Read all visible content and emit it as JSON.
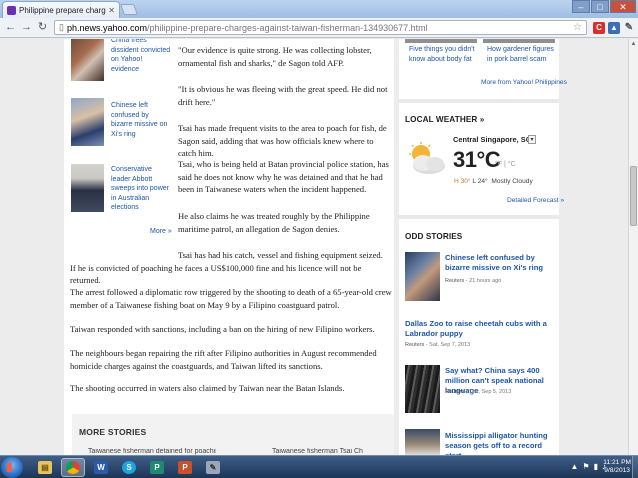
{
  "browser": {
    "tab_title": "Philippine prepare charge",
    "url_host": "ph.news.yahoo.com",
    "url_path": "/philippine-prepare-charges-against-taiwan-fisherman-134930677.html"
  },
  "left_sidebar": {
    "items": [
      {
        "title": "China frees dissident convicted on Yahoo! evidence"
      },
      {
        "title": "Chinese left confused by bizarre missive on Xi's ring"
      },
      {
        "title": "Conservative leader Abbott sweeps into power in Australian elections"
      }
    ],
    "more_label": "More »"
  },
  "article": {
    "paragraphs": [
      "\"Our evidence is quite strong. He was collecting lobster, ornamental fish and sharks,\" de Sagon told AFP.",
      "\"It is obvious he was fleeing with the great speed. He did not drift here.\"",
      "Tsai has made frequent visits to the area to poach for fish, de Sagon said, adding that was how officials knew where to catch him.",
      "Tsai, who is being held at Batan provincial police station, has said he does not know why he was detained and that he had been in Taiwanese waters when the incident happened.",
      "He also claims he was treated roughly by the Philippine maritime patrol, an allegation de Sagon denies.",
      "Tsai has had his catch, vessel and fishing equipment seized. If he is convicted of poaching he faces a US$100,000 fine and his licence will not be returned.",
      "The arrest followed a diplomatic row triggered by the shooting to death of a 65-year-old crew member of a Taiwanese fishing boat on May 9 by a Filipino coastguard patrol.",
      "Taiwan responded with sanctions, including a ban on the hiring of new Filipino workers.",
      "The neighbours began repairing the rift after Filipino authorities in August recommended homicide charges against the coastguards, and Taiwan lifted its sanctions.",
      "The shooting occurred in waters also claimed by Taiwan near the Batan Islands."
    ],
    "more_stories_title": "MORE STORIES",
    "peek_left": "Taiwanese fisherman detained for poaching",
    "peek_right": "Taiwanese fisherman Tsai Ch"
  },
  "right_col": {
    "top_tiles": [
      {
        "caption": "Five things you didn't know about body fat"
      },
      {
        "caption": "How gardener figures in pork barrel scam"
      }
    ],
    "more_from": "More from Yahoo! Philippines",
    "weather": {
      "title": "LOCAL WEATHER",
      "title_suffix": "»",
      "location": "Central Singapore, SG",
      "dropdown": "▾",
      "temp": "31°C",
      "units": "°F | °C",
      "high": "H 30°",
      "low": "L 24°",
      "condition": "Mostly Cloudy",
      "detailed": "Detailed Forecast »"
    },
    "odd_stories": {
      "title": "ODD STORIES",
      "items": [
        {
          "title": "Chinese left confused by bizarre missive on Xi's ring",
          "source": "Reuters",
          "time": " - 21 hours ago"
        },
        {
          "title": "Dallas Zoo to raise cheetah cubs with a Labrador puppy",
          "source": "Reuters",
          "time": " - Sat, Sep 7, 2013"
        },
        {
          "title": "Say what? China says 400 million can't speak national language",
          "source": "Reuters",
          "time": " - Thu, Sep 5, 2013"
        },
        {
          "title": "Mississippi alligator hunting season gets off to a record start",
          "source": "",
          "time": ""
        }
      ]
    }
  },
  "taskbar": {
    "clock_time": "11:21 PM",
    "clock_date": "9/8/2013"
  },
  "colors": {
    "link_blue": "#1f55a8",
    "taskbar": "#1c3557"
  }
}
